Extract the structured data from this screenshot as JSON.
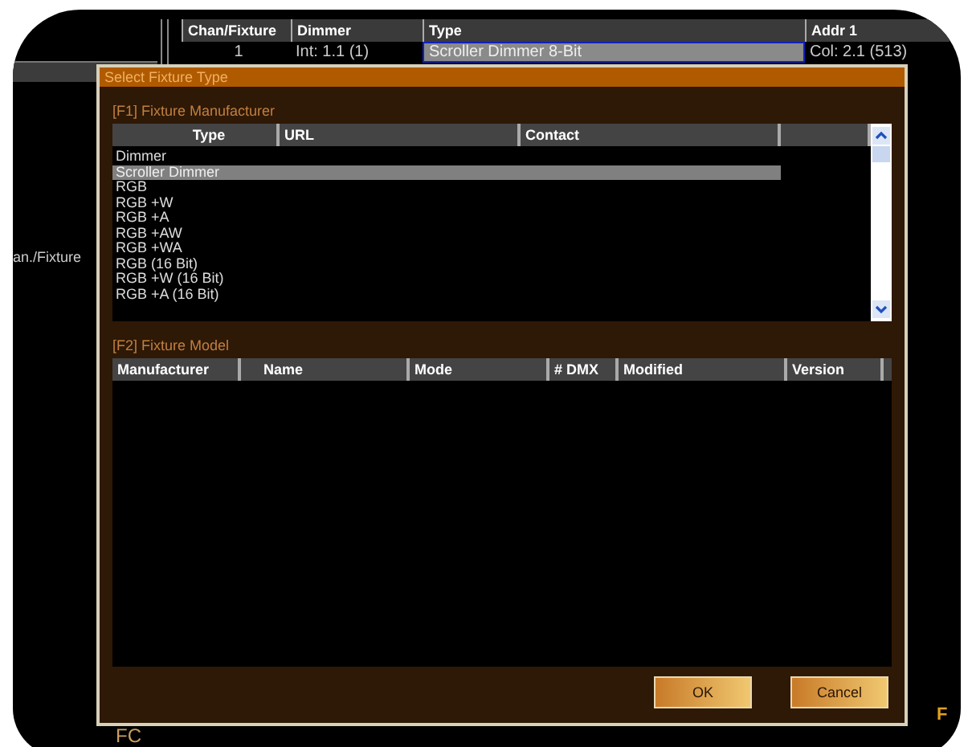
{
  "background": {
    "table": {
      "columns": [
        "Chan/Fixture",
        "Dimmer",
        "Type",
        "Addr 1"
      ],
      "rows": [
        {
          "cells": [
            {
              "text": "1",
              "selected": false
            },
            {
              "text": "Int: 1.1 (1)",
              "selected": false
            },
            {
              "text": "Scroller Dimmer 8-Bit",
              "selected": true
            },
            {
              "text": "Col: 2.1 (513)",
              "selected": false
            }
          ]
        }
      ]
    },
    "side_label": "an./Fixture",
    "bottom_label": "FC",
    "right_label": "F"
  },
  "dialog": {
    "title": "Select Fixture Type",
    "manufacturer": {
      "heading": "[F1] Fixture Manufacturer",
      "columns": [
        "Type",
        "URL",
        "Contact"
      ],
      "rows": [
        {
          "type": "Dimmer",
          "selected": false
        },
        {
          "type": "Scroller Dimmer",
          "selected": true
        },
        {
          "type": "RGB",
          "selected": false
        },
        {
          "type": "RGB +W",
          "selected": false
        },
        {
          "type": "RGB +A",
          "selected": false
        },
        {
          "type": "RGB +AW",
          "selected": false
        },
        {
          "type": "RGB +WA",
          "selected": false
        },
        {
          "type": "RGB (16 Bit)",
          "selected": false
        },
        {
          "type": "RGB +W (16 Bit)",
          "selected": false
        },
        {
          "type": "RGB +A (16 Bit)",
          "selected": false
        }
      ]
    },
    "model": {
      "heading": "[F2] Fixture Model",
      "columns": [
        "Manufacturer",
        "Name",
        "Mode",
        "# DMX",
        "Modified",
        "Version"
      ]
    },
    "buttons": [
      {
        "label": "OK"
      },
      {
        "label": "Cancel"
      }
    ]
  }
}
